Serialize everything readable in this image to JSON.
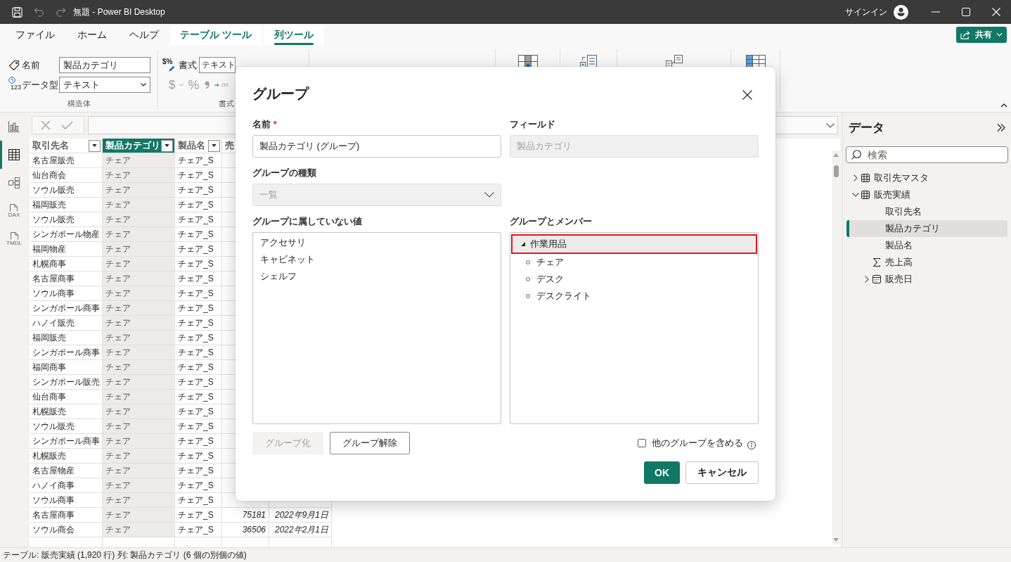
{
  "title_bar": {
    "quick_access": [
      {
        "kind": "save",
        "disabled": false
      },
      {
        "kind": "undo",
        "disabled": true
      },
      {
        "kind": "redo",
        "disabled": true
      }
    ],
    "title": "無題 - Power BI Desktop",
    "sign_in": "サインイン"
  },
  "ribbon_tabs": [
    {
      "label": "ファイル",
      "contextual": false,
      "selected": false
    },
    {
      "label": "ホーム",
      "contextual": false,
      "selected": false
    },
    {
      "label": "ヘルプ",
      "contextual": false,
      "selected": false
    },
    {
      "label": "テーブル ツール",
      "contextual": true,
      "selected": false
    },
    {
      "label": "列ツール",
      "contextual": true,
      "selected": true
    }
  ],
  "share_button": {
    "label": "共有"
  },
  "ribbon": {
    "structure": {
      "name_label": "名前",
      "name_value": "製品カテゴリ",
      "type_icon_text": "123",
      "type_label": "データ型",
      "type_value": "テキスト",
      "group_label": "構造体"
    },
    "format": {
      "icon_text": "$%",
      "format_label": "書式",
      "format_value": "テキスト",
      "buttons": [
        {
          "kind": "currency",
          "label": "$",
          "disabled": true
        },
        {
          "kind": "percent",
          "label": "%",
          "disabled": true
        },
        {
          "kind": "comma",
          "disabled": true
        },
        {
          "kind": "decimal",
          "label": ".00",
          "disabled": true
        }
      ],
      "group_label": "書式"
    },
    "large_buttons": [
      {
        "kind": "grid_sort"
      },
      {
        "kind": "list_add"
      },
      {
        "kind": "list_link"
      },
      {
        "kind": "grid_column"
      }
    ]
  },
  "nav_rail": [
    {
      "kind": "report",
      "selected": false
    },
    {
      "kind": "table",
      "selected": true
    },
    {
      "kind": "model",
      "selected": false
    },
    {
      "kind": "dax",
      "caption": "DAX",
      "selected": false
    },
    {
      "kind": "tmdl",
      "caption": "TMDL",
      "selected": false
    }
  ],
  "formula_bar": {
    "buttons": [
      {
        "kind": "cancel",
        "disabled": true
      },
      {
        "kind": "commit",
        "disabled": true
      }
    ]
  },
  "table": {
    "columns": [
      {
        "label": "取引先名",
        "kind": "text",
        "selected": false
      },
      {
        "label": "製品カテゴリ",
        "kind": "text",
        "selected": true
      },
      {
        "label": "製品名",
        "kind": "text",
        "selected": false
      },
      {
        "partial_label": "売",
        "kind": "number",
        "selected": false
      },
      {
        "kind": "date",
        "selected": false
      }
    ],
    "rows": [
      {
        "cells": [
          "名古屋販売",
          "チェア",
          "チェア_S"
        ]
      },
      {
        "cells": [
          "仙台商会",
          "チェア",
          "チェア_S"
        ]
      },
      {
        "cells": [
          "ソウル販売",
          "チェア",
          "チェア_S"
        ]
      },
      {
        "cells": [
          "福岡販売",
          "チェア",
          "チェア_S"
        ]
      },
      {
        "cells": [
          "ソウル販売",
          "チェア",
          "チェア_S"
        ]
      },
      {
        "cells": [
          "シンガポール物産",
          "チェア",
          "チェア_S"
        ]
      },
      {
        "cells": [
          "福岡物産",
          "チェア",
          "チェア_S"
        ]
      },
      {
        "cells": [
          "札幌商事",
          "チェア",
          "チェア_S"
        ]
      },
      {
        "cells": [
          "名古屋商事",
          "チェア",
          "チェア_S"
        ]
      },
      {
        "cells": [
          "ソウル商事",
          "チェア",
          "チェア_S"
        ]
      },
      {
        "cells": [
          "シンガポール商事",
          "チェア",
          "チェア_S"
        ]
      },
      {
        "cells": [
          "ハノイ販売",
          "チェア",
          "チェア_S"
        ]
      },
      {
        "cells": [
          "福岡販売",
          "チェア",
          "チェア_S"
        ]
      },
      {
        "cells": [
          "シンガポール商事",
          "チェア",
          "チェア_S"
        ]
      },
      {
        "cells": [
          "福岡商事",
          "チェア",
          "チェア_S"
        ]
      },
      {
        "cells": [
          "シンガポール販売",
          "チェア",
          "チェア_S"
        ]
      },
      {
        "cells": [
          "仙台商事",
          "チェア",
          "チェア_S"
        ]
      },
      {
        "cells": [
          "札幌販売",
          "チェア",
          "チェア_S"
        ]
      },
      {
        "cells": [
          "ソウル販売",
          "チェア",
          "チェア_S"
        ]
      },
      {
        "cells": [
          "シンガポール商事",
          "チェア",
          "チェア_S"
        ]
      },
      {
        "cells": [
          "札幌販売",
          "チェア",
          "チェア_S"
        ]
      },
      {
        "cells": [
          "名古屋物産",
          "チェア",
          "チェア_S"
        ]
      },
      {
        "cells": [
          "ハノイ商事",
          "チェア",
          "チェア_S"
        ]
      },
      {
        "cells": [
          "ソウル商事",
          "チェア",
          "チェア_S"
        ]
      },
      {
        "cells": [
          "名古屋商事",
          "チェア",
          "チェア_S",
          "75181",
          "2022年9月1日"
        ]
      },
      {
        "cells": [
          "ソウル商会",
          "チェア",
          "チェア_S",
          "36506",
          "2022年2月1日"
        ]
      }
    ]
  },
  "data_pane": {
    "title": "データ",
    "search_placeholder": "検索",
    "tree": [
      {
        "label": "取引先マスタ",
        "kind": "table",
        "expanded": false,
        "selected": false
      },
      {
        "label": "販売実績",
        "kind": "table",
        "expanded": true,
        "selected": false,
        "children": [
          {
            "label": "取引先名",
            "kind": "field",
            "selected": false
          },
          {
            "label": "製品カテゴリ",
            "kind": "field",
            "selected": true
          },
          {
            "label": "製品名",
            "kind": "field",
            "selected": false
          },
          {
            "label": "売上高",
            "kind": "measure",
            "selected": false
          },
          {
            "label": "販売日",
            "kind": "date",
            "expanded": false,
            "selected": false
          }
        ]
      }
    ]
  },
  "status_bar": {
    "text": "テーブル: 販売実績 (1,920 行) 列: 製品カテゴリ (6 個の別個の値)"
  },
  "dialog": {
    "title": "グループ",
    "name": {
      "label": "名前",
      "required_mark": "*",
      "value": "製品カテゴリ (グループ)"
    },
    "field": {
      "label": "フィールド",
      "value": "製品カテゴリ",
      "disabled": true
    },
    "group_type": {
      "label": "グループの種類",
      "value": "一覧",
      "disabled": true
    },
    "ungrouped": {
      "label": "グループに属していない値",
      "items": [
        {
          "label": "アクセサリ",
          "selected": false
        },
        {
          "label": "キャビネット",
          "selected": false
        },
        {
          "label": "シェルフ",
          "selected": false
        }
      ]
    },
    "groups": {
      "label": "グループとメンバー",
      "items": [
        {
          "label": "作業用品",
          "expanded": true,
          "selected": true,
          "members": [
            {
              "label": "チェア",
              "selected": false
            },
            {
              "label": "デスク",
              "selected": false
            },
            {
              "label": "デスクライト",
              "selected": false
            }
          ]
        }
      ]
    },
    "group_button": {
      "label": "グループ化",
      "disabled": true
    },
    "ungroup_button": {
      "label": "グループ解除",
      "disabled": false
    },
    "include_other": {
      "label": "他のグループを含める",
      "checked": false
    },
    "ok_button": {
      "label": "OK"
    },
    "cancel_button": {
      "label": "キャンセル"
    }
  }
}
